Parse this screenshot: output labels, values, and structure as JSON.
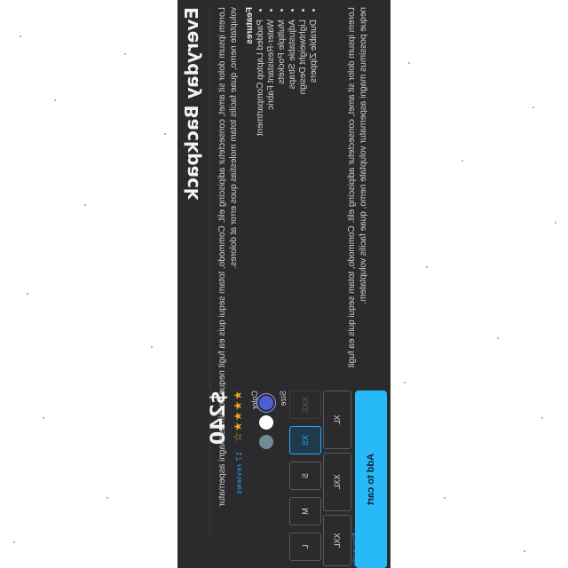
{
  "product": {
    "title": "Everyday Backpack",
    "description_top": "Lorem ipsum dolor sit amet, consectetur adipiscing elit. Commodo, totam sequi quis ea fugit neque possimus magni aspernatur voluptate nemo, quae facilis totam molestias quos error at dolores.",
    "features_label": "Features",
    "features": [
      "Padded Laptop Compartment",
      "Water-Resistant Fabric",
      "Multiple Pockets",
      "Adjustable Straps",
      "Lightweight Design",
      "Durable Zippers"
    ],
    "description_bottom": "Lorem ipsum dolor sit amet, consectetur adipiscing elit. Commodo, totam sequi quis ea fugit neque possimus magni aspernatur voluptate nemo, quae facilis voluptatem."
  },
  "pricing": {
    "price": "$240",
    "rating_stars": "★★★★☆",
    "reviews_link": "17 reviews"
  },
  "color": {
    "label": "Color",
    "swatches": [
      {
        "name": "blue",
        "hex": "#4e5fd1",
        "selected": true
      },
      {
        "name": "white",
        "hex": "#ffffff",
        "selected": false
      },
      {
        "name": "slate",
        "hex": "#6e8d92",
        "selected": false
      }
    ]
  },
  "size": {
    "label": "Size",
    "options": [
      "XXS",
      "XS",
      "S",
      "M",
      "L",
      "XL",
      "XXL",
      "XXL"
    ],
    "selected": "XS",
    "guide_link": "Size guide"
  },
  "actions": {
    "add_to_cart": "Add to cart"
  }
}
